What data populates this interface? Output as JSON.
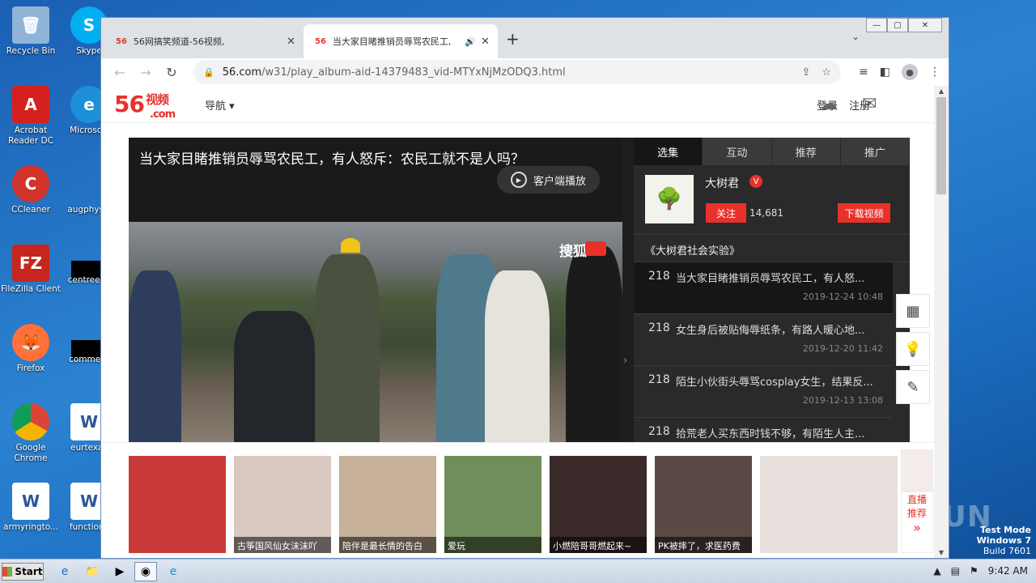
{
  "desktop": {
    "icons": [
      {
        "label": "Recycle Bin",
        "icon": "recycle-bin-icon",
        "color": "#8fb4d8"
      },
      {
        "label": "Skype",
        "icon": "skype-icon",
        "color": "#00aff0"
      },
      {
        "label": "Acrobat Reader DC",
        "icon": "acrobat-icon",
        "color": "#d4201f"
      },
      {
        "label": "Microsoft",
        "icon": "edge-icon",
        "color": "#1e8fd9"
      },
      {
        "label": "CCleaner",
        "icon": "ccleaner-icon",
        "color": "#d0342c"
      },
      {
        "label": "augphysic",
        "icon": "blank-file-icon",
        "color": "#1c6ab5"
      },
      {
        "label": "FileZilla Client",
        "icon": "filezilla-icon",
        "color": "#c6261e"
      },
      {
        "label": "centreeve",
        "icon": "blank-file-icon",
        "color": "#000000"
      },
      {
        "label": "Firefox",
        "icon": "firefox-icon",
        "color": "#ff7139"
      },
      {
        "label": "comment",
        "icon": "blank-file-icon",
        "color": "#000000"
      },
      {
        "label": "Google Chrome",
        "icon": "chrome-icon",
        "color": "#4285f4"
      },
      {
        "label": "eurtexas",
        "icon": "word-doc-icon",
        "color": "#2b5797"
      },
      {
        "label": "armyringto...",
        "icon": "word-doc-icon",
        "color": "#2b5797"
      },
      {
        "label": "functions",
        "icon": "word-doc-icon",
        "color": "#2b5797"
      }
    ]
  },
  "browser": {
    "tabs": [
      {
        "favicon": "56",
        "title": "56网搞笑频道-56视频,",
        "close": "✕"
      },
      {
        "favicon": "56",
        "title": "当大家目睹推销员辱骂农民工,",
        "close": "✕",
        "audio": "🔊"
      }
    ],
    "new_tab": "+",
    "tab_menu": "⌄",
    "window_controls": {
      "min": "—",
      "max": "▢",
      "close": "✕"
    },
    "url_domain": "56.com",
    "url_path": "/w31/play_album-aid-14379483_vid-MTYxNjMzODQ3.html"
  },
  "site": {
    "logo_main": "56",
    "logo_sup": "视频",
    "logo_sub": ".com",
    "nav_label": "导航 ▾",
    "login": "登录",
    "register": "注册",
    "accent": "#e8312b"
  },
  "video": {
    "title": "当大家目睹推销员辱骂农民工，有人怒斥：农民工就不是人吗？",
    "client_play": "客户端播放",
    "watermark": "搜狐"
  },
  "sidebar": {
    "tabs": [
      "选集",
      "互动",
      "推荐",
      "推广"
    ],
    "author_name": "大树君",
    "verified": "V",
    "follow": "关注",
    "fans": "14,681",
    "download": "下载视频",
    "album": "《大树君社会实验》",
    "episodes": [
      {
        "num": "218",
        "title": "当大家目睹推销员辱骂农民工，有人怒...",
        "date": "2019-12-24 10:48"
      },
      {
        "num": "218",
        "title": "女生身后被贴侮辱纸条，有路人暖心地...",
        "date": "2019-12-20 11:42"
      },
      {
        "num": "218",
        "title": "陌生小伙街头辱骂cosplay女生，结果反...",
        "date": "2019-12-13 13:08"
      },
      {
        "num": "218",
        "title": "拾荒老人买东西时钱不够，有陌生人主...",
        "date": ""
      }
    ]
  },
  "thumbs": [
    {
      "caption": "",
      "bg": "#c83a3a"
    },
    {
      "caption": "古筝国风仙女沫沫吖",
      "bg": "#d9c8c0"
    },
    {
      "caption": "陪伴是最长情的告白",
      "bg": "#c7b19a"
    },
    {
      "caption": "爱玩",
      "bg": "#6f8e5a"
    },
    {
      "caption": "小燃陪哥哥燃起来~",
      "bg": "#3b2a2a"
    },
    {
      "caption": "PK被摔了，求医药费",
      "bg": "#5a4a45"
    },
    {
      "caption": "",
      "bg": "#e8e0dc"
    }
  ],
  "live_rec": {
    "line1": "直播",
    "line2": "推荐",
    "more": "»"
  },
  "taskbar": {
    "start": "Start",
    "time": "9:42 AM"
  },
  "watermark_os": {
    "line1": "Test Mode",
    "line2": "Windows 7",
    "line3": "Build 7601"
  },
  "anyrun": "ANY.RUN"
}
